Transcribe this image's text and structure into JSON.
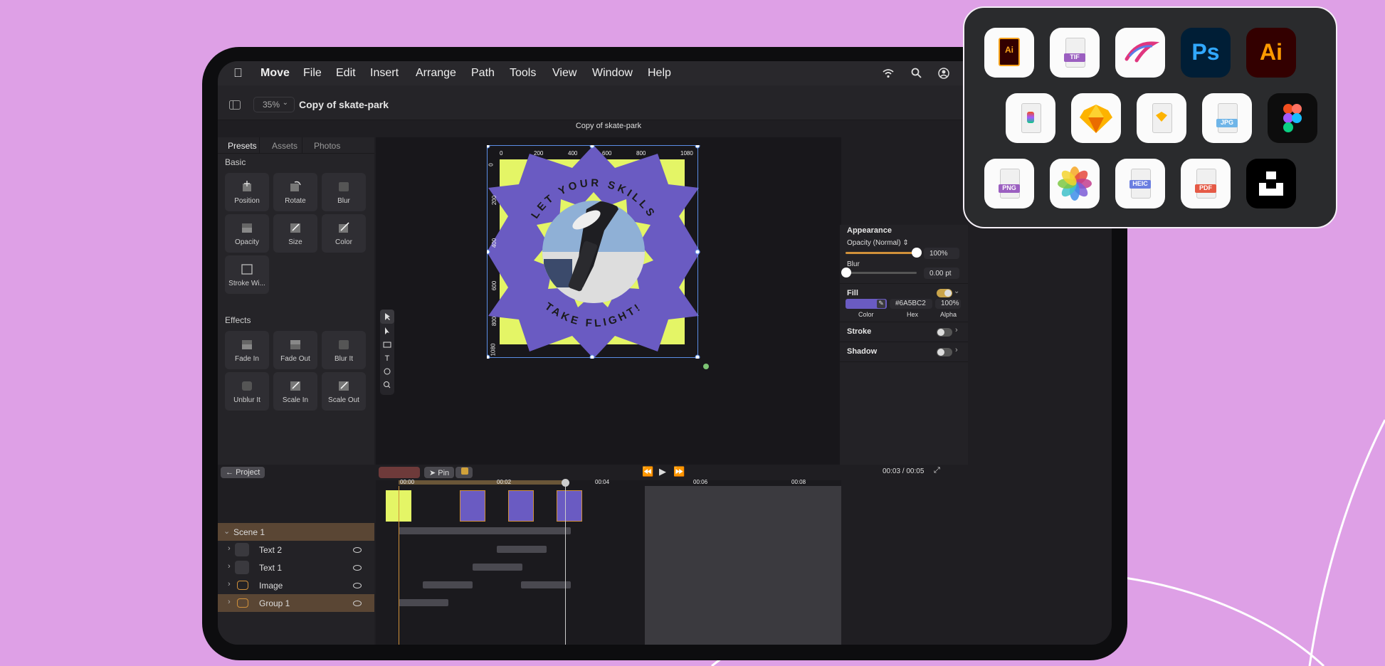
{
  "menubar": {
    "items": [
      "Move",
      "File",
      "Edit",
      "Insert",
      "Arrange",
      "Path",
      "Tools",
      "View",
      "Window",
      "Help"
    ]
  },
  "toolbar": {
    "zoom": "35%",
    "document_title": "Copy of skate-park"
  },
  "canvas": {
    "title": "Copy of skate-park",
    "ruler_top": [
      "0",
      "200",
      "400",
      "600",
      "800",
      "1080"
    ],
    "ruler_left": [
      "0",
      "200",
      "400",
      "600",
      "800",
      "1080"
    ],
    "artwork": {
      "headline": "LET YOUR SKILLS",
      "tagline": "TAKE FLIGHT!"
    }
  },
  "left_panel": {
    "tabs": [
      "Presets",
      "Assets",
      "Photos"
    ],
    "basic_label": "Basic",
    "basic": [
      "Position",
      "Rotate",
      "Blur",
      "Opacity",
      "Size",
      "Color",
      "Stroke Wi..."
    ],
    "effects_label": "Effects",
    "effects": [
      "Fade In",
      "Fade Out",
      "Blur It",
      "Unblur It",
      "Scale In",
      "Scale Out"
    ]
  },
  "right_panel": {
    "appearance": "Appearance",
    "opacity_label": "Opacity (Normal)",
    "opacity_value": "100%",
    "opacity_level": 1.0,
    "blur_label": "Blur",
    "blur_value": "0.00 pt",
    "fill_label": "Fill",
    "fill_hex": "#6A5BC2",
    "fill_alpha": "100%",
    "fill_color_label": "Color",
    "fill_hex_label": "Hex",
    "fill_alpha_label": "Alpha",
    "stroke_label": "Stroke",
    "shadow_label": "Shadow",
    "fill_color": "#6A5BC2"
  },
  "timeline": {
    "project_button": "Project",
    "pin_button": "Pin",
    "time": "00:03 / 00:05",
    "ticks": [
      "00:00",
      "00:02",
      "00:04",
      "00:06",
      "00:08"
    ]
  },
  "layers": [
    {
      "name": "Scene 1"
    },
    {
      "name": "Text 2"
    },
    {
      "name": "Text 1"
    },
    {
      "name": "Image"
    },
    {
      "name": "Group 1"
    }
  ],
  "apps": {
    "row1": [
      "ai-file-icon",
      "tif-file-icon",
      "procreate-icon",
      "photoshop-icon",
      "illustrator-icon"
    ],
    "row2": [
      "figma-file-icon",
      "sketch-icon",
      "sketch-file-icon",
      "jpg-file-icon",
      "figma-icon"
    ],
    "row3": [
      "png-file-icon",
      "photos-icon",
      "heic-file-icon",
      "pdf-file-icon",
      "unsplash-icon"
    ],
    "labels": {
      "ai": "Ai",
      "tif": "TIF",
      "ps": "Ps",
      "ai_big": "Ai",
      "jpg": "JPG",
      "png": "PNG",
      "heic": "HEIC",
      "pdf": "PDF"
    }
  },
  "colors": {
    "background": "#dea0e6",
    "artwork_purple": "#6A5BC2",
    "artwork_lime": "#e4f566",
    "accent_orange": "#d0903a"
  }
}
